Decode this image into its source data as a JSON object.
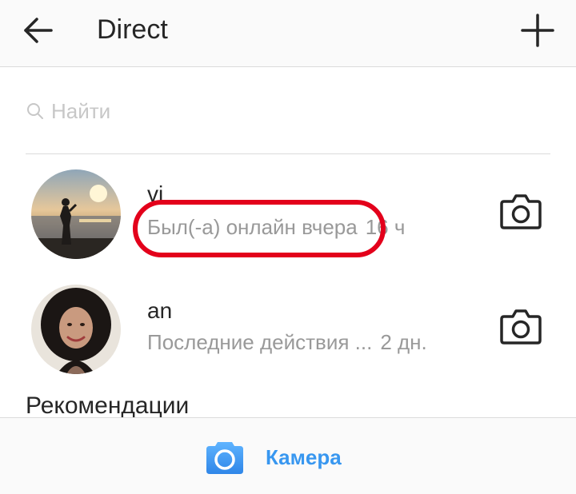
{
  "header": {
    "title": "Direct"
  },
  "search": {
    "placeholder": "Найти",
    "value": ""
  },
  "threads": [
    {
      "name": "vi",
      "status": "Был(-а) онлайн вчера",
      "time": "16 ч"
    },
    {
      "name": "an",
      "status": "Последние действия ...",
      "time": "2 дн."
    }
  ],
  "section": {
    "title": "Рекомендации"
  },
  "bottom": {
    "camera_label": "Камера"
  },
  "colors": {
    "accent": "#3897f0",
    "highlight": "#e3001b",
    "muted": "#999999",
    "text": "#262626"
  },
  "icons": {
    "back": "arrow-left-icon",
    "new": "plus-icon",
    "search": "search-icon",
    "camera": "camera-outline-icon",
    "camera_filled": "camera-filled-icon"
  }
}
